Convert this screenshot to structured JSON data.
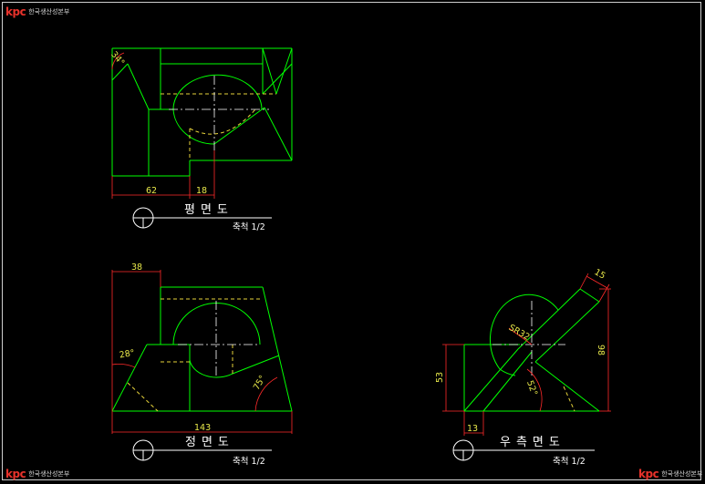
{
  "logo": {
    "mark": "kpc",
    "text": "한국생산성본부"
  },
  "views": {
    "plan": {
      "title": "평면도",
      "scale": "축척 1/2",
      "dims": {
        "w62": "62",
        "w18": "18",
        "angle": "34°"
      }
    },
    "front": {
      "title": "정면도",
      "scale": "축척 1/2",
      "dims": {
        "w38": "38",
        "w143": "143",
        "a28": "28°",
        "a75": "75°"
      }
    },
    "side": {
      "title": "우측면도",
      "scale": "축척 1/2",
      "dims": {
        "h53": "53",
        "w13": "13",
        "h98": "98",
        "w15": "15",
        "sr": "SR32",
        "a52": "52°"
      }
    }
  },
  "colors": {
    "outline": "#00ff00",
    "hidden": "#e6d23a",
    "dimension": "#ff2a2a",
    "center": "#ffffff",
    "text": "#e8e84a"
  }
}
